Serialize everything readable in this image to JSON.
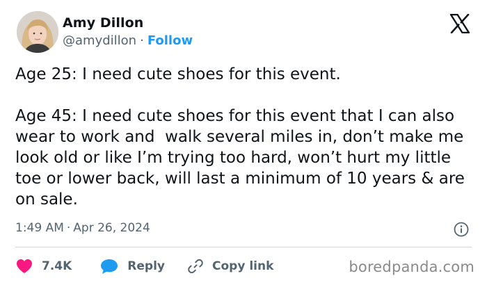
{
  "author": {
    "display_name": "Amy Dillon",
    "handle": "@amydillon",
    "separator": "·",
    "follow_label": "Follow"
  },
  "tweet": {
    "paragraphs": [
      "Age 25: I need cute shoes for this event.",
      "Age 45: I need cute shoes for this event that I can also wear to work and  walk several miles in, don’t make me look old or like I’m trying too hard, won’t hurt my little toe or lower back, will last a minimum of 10 years & are on sale."
    ]
  },
  "meta": {
    "time": "1:49 AM",
    "separator": "·",
    "date": "Apr 26, 2024"
  },
  "actions": {
    "likes": "7.4K",
    "reply_label": "Reply",
    "copy_link_label": "Copy link"
  },
  "watermark": "boredpanda.com",
  "icons": {
    "platform": "x-logo-icon",
    "info": "info-icon",
    "like": "heart-icon",
    "reply": "speech-bubble-icon",
    "copy_link": "link-icon"
  },
  "colors": {
    "text": "#0f1419",
    "secondary": "#536471",
    "accent": "#1d9bf0",
    "like": "#f91880",
    "divider": "#cfd9de",
    "watermark": "#8a8a8a"
  }
}
